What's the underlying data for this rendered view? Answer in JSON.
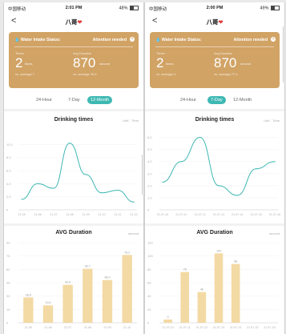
{
  "screens": [
    {
      "status_bar": {
        "carrier": "中国移动",
        "time": "2:01 PM",
        "battery": "48%",
        "battery_level": 0.48
      },
      "nav": {
        "back": "<",
        "title": "八哥",
        "heart": "❤"
      },
      "card": {
        "status_label": "Water Intake Status:",
        "status_value": "Attention needed",
        "left_label": "Times",
        "left_value": "2",
        "left_unit": "times",
        "left_avg": "vs. average 7",
        "right_label": "Avg Duration",
        "right_value": "870",
        "right_unit": "second",
        "right_avg": "vs. average 76.4"
      },
      "tabs": {
        "items": [
          "24-Hour",
          "7-Day",
          "12-Month"
        ],
        "active": 2
      },
      "chart_data": [
        {
          "type": "line",
          "title": "Drinking times",
          "unit_label": "Unit：Time",
          "x": [
            "21-05",
            "21-06",
            "21-07",
            "21-08",
            "21-09",
            "21-10",
            "21-11",
            "21-12"
          ],
          "values": [
            1.6,
            4.0,
            3.3,
            10.2,
            5.4,
            2.6,
            3.0,
            1.2
          ],
          "yticks": [
            "0",
            "2.0",
            "4.0",
            "6.0",
            "8.0",
            "10.0"
          ],
          "ylim": [
            0,
            12
          ],
          "color": "#3fb8b3"
        },
        {
          "type": "bar",
          "title": "AVG Duration",
          "unit_label": "second",
          "categories": [
            "21-05",
            "21-06",
            "21-07",
            "21-08",
            "21-09",
            "21-10"
          ],
          "values": [
            28.5,
            19.6,
            42.6,
            60.7,
            48.0,
            76.2
          ],
          "value_labels": [
            "28.5",
            "19.6",
            "42.6",
            "60.7",
            "48.0",
            "76.2"
          ],
          "yticks": [
            "0",
            "15",
            "30",
            "45",
            "60",
            "75",
            "90"
          ],
          "ylim": [
            0,
            90
          ],
          "color": "#f3d9a3"
        }
      ]
    },
    {
      "status_bar": {
        "carrier": "中国移动",
        "time": "2:00 PM",
        "battery": "49%",
        "battery_level": 0.49
      },
      "nav": {
        "back": "<",
        "title": "八哥",
        "heart": "❤"
      },
      "card": {
        "status_label": "Water Intake Status:",
        "status_value": "Attention needed",
        "left_label": "Times",
        "left_value": "2",
        "left_unit": "times",
        "left_avg": "vs. average 4",
        "right_label": "Avg Duration",
        "right_value": "870",
        "right_unit": "second",
        "right_avg": "vs. average 77.4"
      },
      "tabs": {
        "items": [
          "24-Hour",
          "7-Day",
          "12-Month"
        ],
        "active": 1
      },
      "chart_data": [
        {
          "type": "line",
          "title": "Drinking times",
          "unit_label": "Unit：Time",
          "x": [
            "21-07-10",
            "21-07-11",
            "21-07-12",
            "21-07-13",
            "21-07-14",
            "21-07-15",
            "21-07-16"
          ],
          "values": [
            2.3,
            4.0,
            6.0,
            2.0,
            1.2,
            3.4,
            4.0
          ],
          "yticks": [
            "0",
            "1.0",
            "2.0",
            "3.0",
            "4.0",
            "5.0",
            "6.0"
          ],
          "ylim": [
            0,
            6.5
          ],
          "color": "#3fb8b3"
        },
        {
          "type": "bar",
          "title": "AVG Duration",
          "unit_label": "second",
          "categories": [
            "21-07-10",
            "21-07-11",
            "21-07-12",
            "21-07-13",
            "21-07-14",
            "21-07-15",
            "21-07-16"
          ],
          "values": [
            5,
            76,
            46,
            104,
            88
          ],
          "value_labels": [
            "5",
            "76",
            "46",
            "104",
            "88"
          ],
          "yticks": [
            "0",
            "20",
            "40",
            "60",
            "80",
            "100",
            "120"
          ],
          "ylim": [
            0,
            120
          ],
          "color": "#f3d9a3"
        }
      ]
    }
  ]
}
